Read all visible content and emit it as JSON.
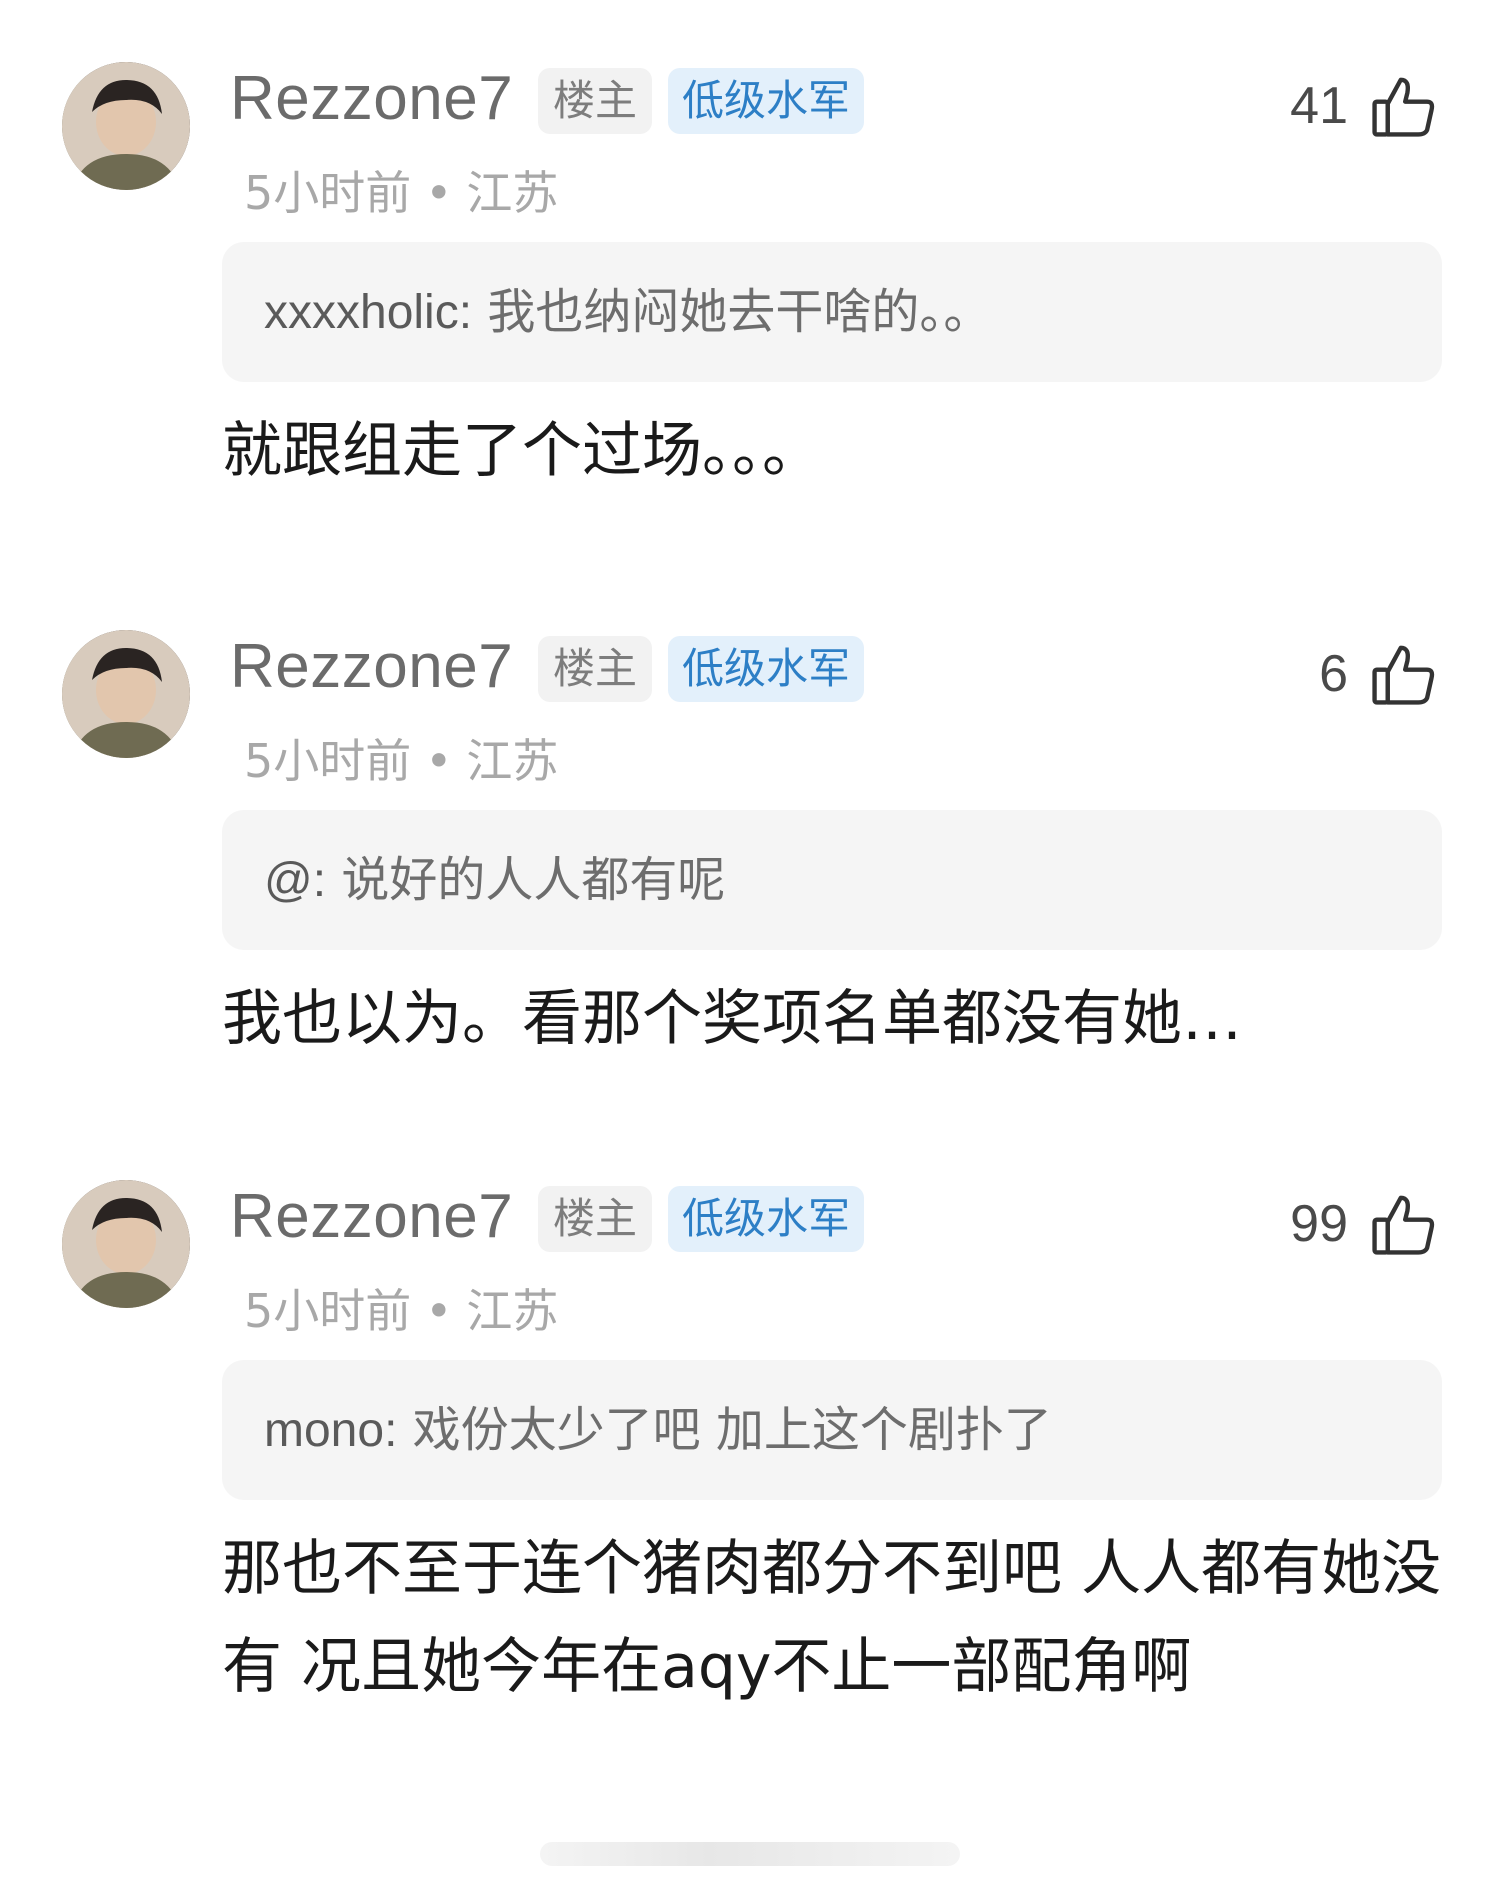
{
  "comments": [
    {
      "username": "Rezzone7",
      "owner_tag": "楼主",
      "level_tag": "低级水军",
      "likes": "41",
      "time": "5小时前",
      "location": "江苏",
      "quote_user": "xxxxholic:",
      "quote_text": "我也纳闷她去干啥的。。",
      "body": "就跟组走了个过场。。。"
    },
    {
      "username": "Rezzone7",
      "owner_tag": "楼主",
      "level_tag": "低级水军",
      "likes": "6",
      "time": "5小时前",
      "location": "江苏",
      "quote_user": "@:",
      "quote_text": "说好的人人都有呢",
      "body": "我也以为。看那个奖项名单都没有她…"
    },
    {
      "username": "Rezzone7",
      "owner_tag": "楼主",
      "level_tag": "低级水军",
      "likes": "99",
      "time": "5小时前",
      "location": "江苏",
      "quote_user": "mono:",
      "quote_text": "戏份太少了吧 加上这个剧扑了",
      "body": "那也不至于连个猪肉都分不到吧 人人都有她没有 况且她今年在aqy不止一部配角啊"
    }
  ],
  "separator": "•",
  "icons": {
    "like": "thumbs-up-icon",
    "avatar": "user-avatar"
  },
  "colors": {
    "level_tag_bg": "#e3f0fb",
    "level_tag_text": "#2d7fc6",
    "quote_bg": "#f5f5f5"
  }
}
